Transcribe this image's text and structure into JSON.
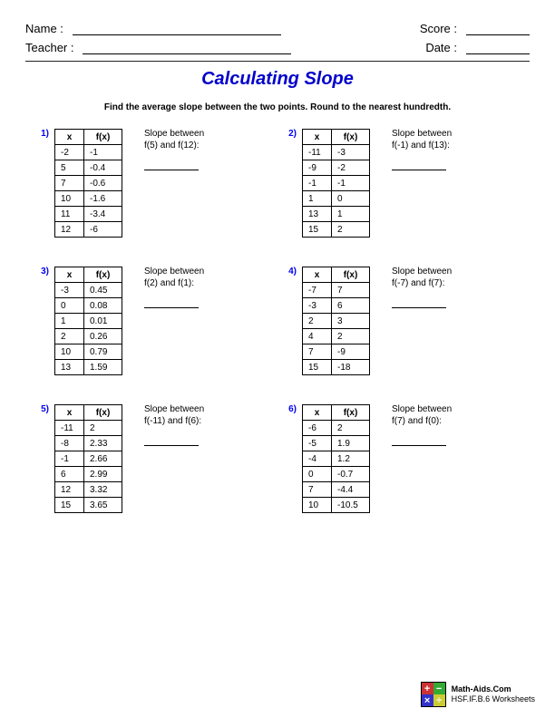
{
  "header": {
    "name_label": "Name :",
    "score_label": "Score :",
    "teacher_label": "Teacher :",
    "date_label": "Date :"
  },
  "title": "Calculating Slope",
  "instructions": "Find the average slope between the two points. Round to the nearest hundredth.",
  "col_x": "x",
  "col_fx": "f(x)",
  "slope_label": "Slope between",
  "problems": [
    {
      "num": "1)",
      "points_text": "f(5) and f(12):",
      "rows": [
        [
          "-2",
          "-1"
        ],
        [
          "5",
          "-0.4"
        ],
        [
          "7",
          "-0.6"
        ],
        [
          "10",
          "-1.6"
        ],
        [
          "11",
          "-3.4"
        ],
        [
          "12",
          "-6"
        ]
      ]
    },
    {
      "num": "2)",
      "points_text": "f(-1) and f(13):",
      "rows": [
        [
          "-11",
          "-3"
        ],
        [
          "-9",
          "-2"
        ],
        [
          "-1",
          "-1"
        ],
        [
          "1",
          "0"
        ],
        [
          "13",
          "1"
        ],
        [
          "15",
          "2"
        ]
      ]
    },
    {
      "num": "3)",
      "points_text": "f(2) and f(1):",
      "rows": [
        [
          "-3",
          "0.45"
        ],
        [
          "0",
          "0.08"
        ],
        [
          "1",
          "0.01"
        ],
        [
          "2",
          "0.26"
        ],
        [
          "10",
          "0.79"
        ],
        [
          "13",
          "1.59"
        ]
      ]
    },
    {
      "num": "4)",
      "points_text": "f(-7) and f(7):",
      "rows": [
        [
          "-7",
          "7"
        ],
        [
          "-3",
          "6"
        ],
        [
          "2",
          "3"
        ],
        [
          "4",
          "2"
        ],
        [
          "7",
          "-9"
        ],
        [
          "15",
          "-18"
        ]
      ]
    },
    {
      "num": "5)",
      "points_text": "f(-11) and f(6):",
      "rows": [
        [
          "-11",
          "2"
        ],
        [
          "-8",
          "2.33"
        ],
        [
          "-1",
          "2.66"
        ],
        [
          "6",
          "2.99"
        ],
        [
          "12",
          "3.32"
        ],
        [
          "15",
          "3.65"
        ]
      ]
    },
    {
      "num": "6)",
      "points_text": "f(7) and f(0):",
      "rows": [
        [
          "-6",
          "2"
        ],
        [
          "-5",
          "1.9"
        ],
        [
          "-4",
          "1.2"
        ],
        [
          "0",
          "-0.7"
        ],
        [
          "7",
          "-4.4"
        ],
        [
          "10",
          "-10.5"
        ]
      ]
    }
  ],
  "footer": {
    "sitename": "Math-Aids.Com",
    "standard": "HSF.IF.B.6 Worksheets",
    "logo": [
      "+",
      "−",
      "×",
      "÷"
    ]
  }
}
